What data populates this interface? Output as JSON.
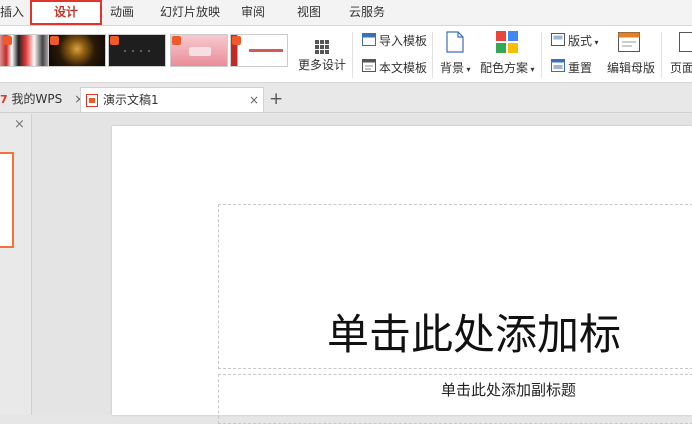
{
  "menu": {
    "insert_partial": "插入",
    "design": "设计",
    "animation": "动画",
    "slideshow": "幻灯片放映",
    "review": "审阅",
    "view": "视图",
    "cloud": "云服务"
  },
  "ribbon": {
    "more_design": "更多设计",
    "import_template": "导入模板",
    "text_template": "本文模板",
    "background": "背景",
    "color_scheme": "配色方案",
    "layout": "版式",
    "reset": "重置",
    "edit_master": "编辑母版",
    "page_partial": "页面"
  },
  "tabs": {
    "home_tab": "我的WPS",
    "doc_tab": "演示文稿1",
    "close_glyph": "×",
    "add_glyph": "+"
  },
  "left_panel": {
    "close_glyph": "×"
  },
  "slide": {
    "title_placeholder": "单击此处添加标",
    "subtitle_placeholder": "单击此处添加副标题"
  },
  "colors": {
    "accent": "#e0342d",
    "wps_orange": "#f05a28"
  }
}
